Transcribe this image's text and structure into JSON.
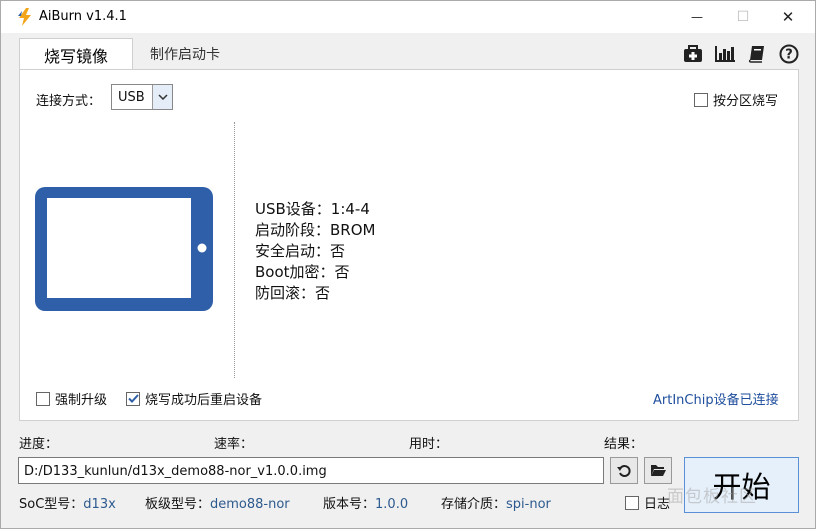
{
  "window": {
    "title": "AiBurn v1.4.1",
    "min_glyph": "—",
    "max_glyph": "☐",
    "close_glyph": "✕"
  },
  "tabs": [
    {
      "label": "烧写镜像",
      "active": true
    },
    {
      "label": "制作启动卡",
      "active": false
    }
  ],
  "toolbar_icons": [
    "first-aid-icon",
    "bar-chart-icon",
    "book-icon",
    "help-icon"
  ],
  "connection": {
    "label": "连接方式：",
    "selected": "USB"
  },
  "partition_burn": {
    "label": "按分区烧写",
    "checked": false
  },
  "device_info": [
    "USB设备：1:4-4",
    "启动阶段：BROM",
    "安全启动：否",
    "Boot加密：否",
    "防回滚：否"
  ],
  "options": {
    "force_upgrade": {
      "label": "强制升级",
      "checked": false
    },
    "reboot_after": {
      "label": "烧写成功后重启设备",
      "checked": true
    }
  },
  "status_connected": "ArtInChip设备已连接",
  "progress": {
    "progress_label": "进度：",
    "speed_label": "速率：",
    "time_label": "用时：",
    "result_label": "结果："
  },
  "image_path": "D:/D133_kunlun/d13x_demo88-nor_v1.0.0.img",
  "start_button": "开始",
  "footer": {
    "soc_label": "SoC型号：",
    "soc_value": "d13x",
    "board_label": "板级型号：",
    "board_value": "demo88-nor",
    "version_label": "版本号：",
    "version_value": "1.0.0",
    "storage_label": "存储介质：",
    "storage_value": "spi-nor",
    "log_label": "日志"
  },
  "watermark": "面包板社区",
  "colors": {
    "device_blue": "#2f5fa8",
    "link_blue": "#1e4e9c",
    "value_blue": "#2d5a8e"
  }
}
